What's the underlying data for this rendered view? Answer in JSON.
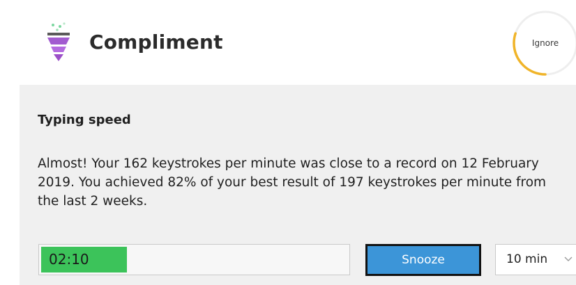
{
  "header": {
    "app_icon": "funnel-icon",
    "title": "Compliment",
    "ignore_label": "Ignore",
    "ignore_progress": 0.3
  },
  "panel": {
    "section_title": "Typing speed",
    "message": "Almost! Your 162 keystrokes per minute was close to a record on 12 February 2019. You achieved 82% of your best result of 197 keystrokes per minute from the last 2 weeks."
  },
  "footer": {
    "timer_text": "02:10",
    "timer_progress": 0.28,
    "snooze_label": "Snooze",
    "snooze_duration": "10 min"
  },
  "colors": {
    "accent_blue": "#3c95d8",
    "timer_green": "#3cc35a",
    "ring_amber": "#f0b429",
    "panel_bg": "#f0f0f0"
  }
}
